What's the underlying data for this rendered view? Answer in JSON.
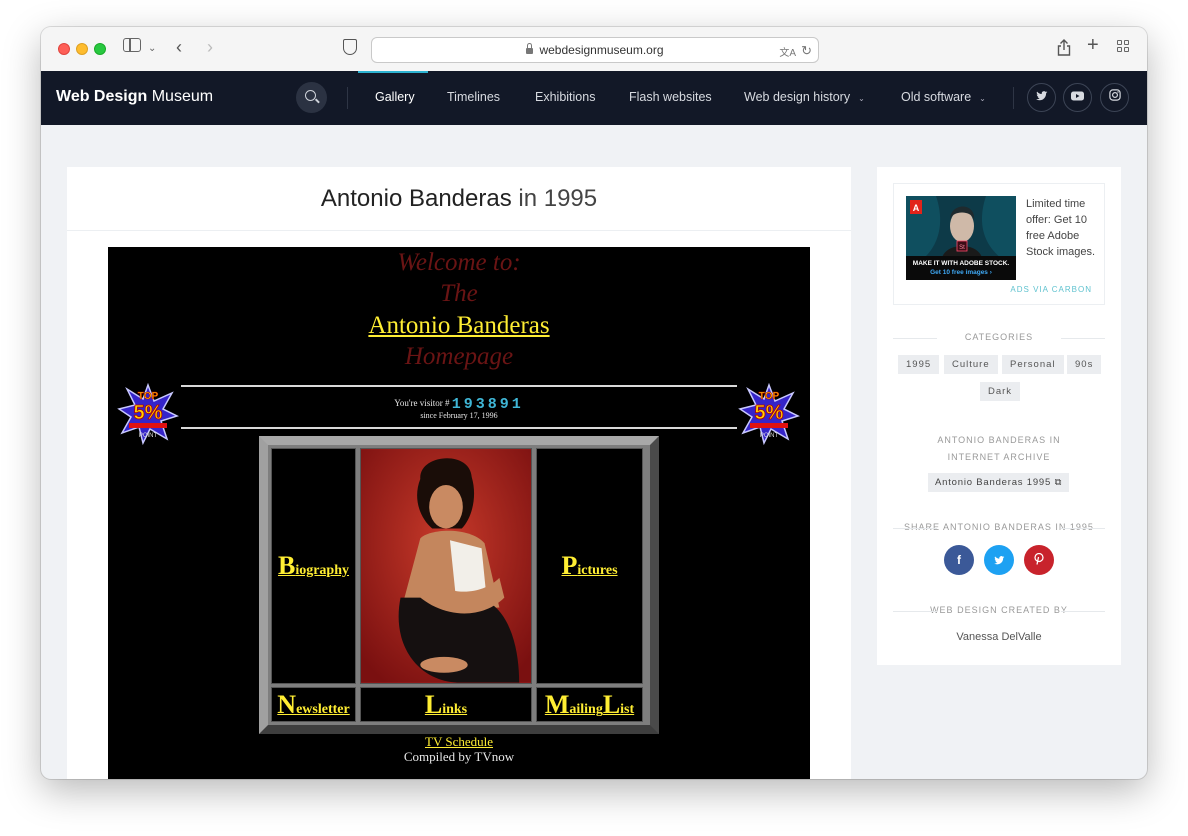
{
  "browser": {
    "url": "webdesignmuseum.org"
  },
  "nav": {
    "brand_bold": "Web Design",
    "brand_light": " Museum",
    "items": [
      {
        "label": "Gallery"
      },
      {
        "label": "Timelines"
      },
      {
        "label": "Exhibitions"
      },
      {
        "label": "Flash websites"
      },
      {
        "label": "Web design history"
      },
      {
        "label": "Old software"
      }
    ],
    "active_item": "Gallery",
    "social_icons": [
      "twitter-icon",
      "youtube-icon",
      "instagram-icon"
    ],
    "accent_color": "#2db3d1"
  },
  "page": {
    "title_name": "Antonio Banderas",
    "title_suffix": " in 1995"
  },
  "screenshot": {
    "welcome_line1": "Welcome to:",
    "welcome_line2": "The",
    "name": "Antonio Banderas",
    "welcome_line3": "Homepage",
    "visitor_prefix": "You're visitor #",
    "visitor_count": "193891",
    "since": "since February 17, 1996",
    "badge_text": "TOP 5%",
    "links": {
      "biography": {
        "cap": "B",
        "rest": "iography"
      },
      "pictures": {
        "cap": "P",
        "rest": "ictures"
      },
      "newsletter": {
        "cap": "N",
        "rest": "ewsletter"
      },
      "links": {
        "cap": "L",
        "rest": "inks"
      },
      "mailing_cap1": "M",
      "mailing_mid": "ailing",
      "mailing_cap2": "L",
      "mailing_rest": "ist"
    },
    "tv_schedule": "TV Schedule",
    "compiled_by": "Compiled by TVnow"
  },
  "sidebar": {
    "ad": {
      "image_caption_1": "MAKE IT WITH ADOBE STOCK.",
      "image_caption_2": "Get 10 free images ›",
      "text": "Limited time offer: Get 10 free Adobe Stock images.",
      "via": "ADS VIA CARBON"
    },
    "categories_heading": "CATEGORIES",
    "categories": [
      "1995",
      "Culture",
      "Personal",
      "90s",
      "Dark"
    ],
    "archive_heading": "ANTONIO BANDERAS IN INTERNET ARCHIVE",
    "archive_button": "Antonio Banderas 1995",
    "share_heading": "SHARE ANTONIO BANDERAS IN 1995",
    "share_buttons": [
      {
        "icon": "facebook-icon",
        "color": "#3b5998"
      },
      {
        "icon": "twitter-icon",
        "color": "#1da1f2"
      },
      {
        "icon": "pinterest-icon",
        "color": "#c8232c"
      }
    ],
    "created_heading": "WEB DESIGN CREATED BY",
    "creator": "Vanessa DelValle"
  }
}
